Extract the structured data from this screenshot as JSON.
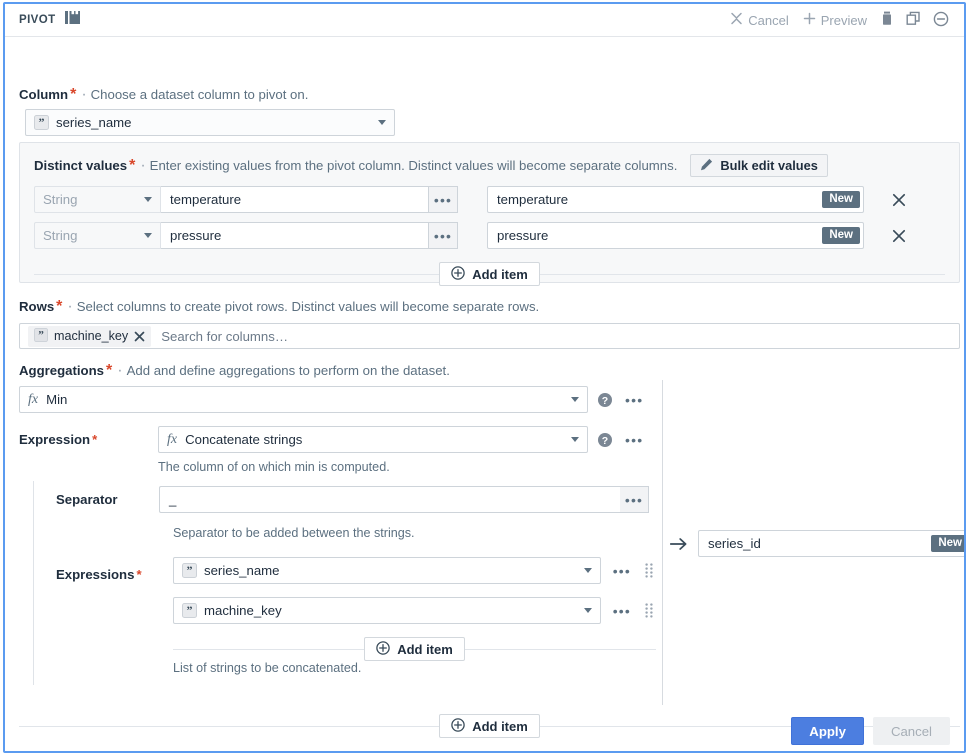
{
  "header": {
    "title": "PIVOT",
    "icon": "pivot-table-icon",
    "actions": {
      "cancel": "Cancel",
      "preview": "Preview",
      "delete_icon": "trash-icon",
      "duplicate_icon": "copy-icon",
      "collapse_icon": "minus-circle-icon"
    }
  },
  "column": {
    "label": "Column",
    "required": "*",
    "separator": "·",
    "description": "Choose a dataset column to pivot on.",
    "value": "series_name",
    "value_icon": "string-column-icon"
  },
  "distinct_values": {
    "label": "Distinct values",
    "required": "*",
    "separator": "·",
    "description": "Enter existing values from the pivot column. Distinct values will become separate columns.",
    "bulk_edit_label": "Bulk edit values",
    "bulk_edit_icon": "pencil-icon",
    "rows": [
      {
        "type": "String",
        "value": "temperature",
        "output": "temperature",
        "badge": "New",
        "menu_icon": "ellipsis-icon",
        "remove_icon": "close-icon"
      },
      {
        "type": "String",
        "value": "pressure",
        "output": "pressure",
        "badge": "New",
        "menu_icon": "ellipsis-icon",
        "remove_icon": "close-icon"
      }
    ],
    "add_item_label": "Add item",
    "add_item_icon": "plus-circle-icon"
  },
  "rows_section": {
    "label": "Rows",
    "required": "*",
    "separator": "·",
    "description": "Select columns to create pivot rows. Distinct values will become separate rows.",
    "chips": [
      {
        "label": "machine_key",
        "icon": "string-column-icon",
        "remove_icon": "close-icon"
      }
    ],
    "placeholder": "Search for columns…"
  },
  "aggregations": {
    "label": "Aggregations",
    "required": "*",
    "separator": "·",
    "description": "Add and define aggregations to perform on the dataset.",
    "function": {
      "value": "Min",
      "icon": "function-icon",
      "help_icon": "help-circle-icon",
      "menu_icon": "ellipsis-icon"
    },
    "expression": {
      "label": "Expression",
      "required": "*",
      "value": "Concatenate strings",
      "icon": "function-icon",
      "help_icon": "help-circle-icon",
      "menu_icon": "ellipsis-icon",
      "help_text": "The column of on which min is computed."
    },
    "separator_field": {
      "label": "Separator",
      "value": "_",
      "menu_icon": "ellipsis-icon",
      "help_text": "Separator to be added between the strings."
    },
    "expressions_field": {
      "label": "Expressions",
      "required": "*",
      "items": [
        {
          "value": "series_name",
          "icon": "string-column-icon",
          "menu_icon": "ellipsis-icon",
          "grip_icon": "drag-handle-icon"
        },
        {
          "value": "machine_key",
          "icon": "string-column-icon",
          "menu_icon": "ellipsis-icon",
          "grip_icon": "drag-handle-icon"
        }
      ],
      "add_item_label": "Add item",
      "add_item_icon": "plus-circle-icon",
      "help_text": "List of strings to be concatenated."
    },
    "output": {
      "arrow_icon": "arrow-right-icon",
      "value": "series_id",
      "badge": "New"
    },
    "add_item_label": "Add item",
    "add_item_icon": "plus-circle-icon"
  },
  "footer": {
    "apply": "Apply",
    "cancel": "Cancel"
  },
  "colors": {
    "accent": "#4c7ee0",
    "border_focus": "#5b9bf0",
    "badge": "#5c7080",
    "required": "#d9472b",
    "text": "#1f2d3d",
    "muted": "#5c7080"
  }
}
